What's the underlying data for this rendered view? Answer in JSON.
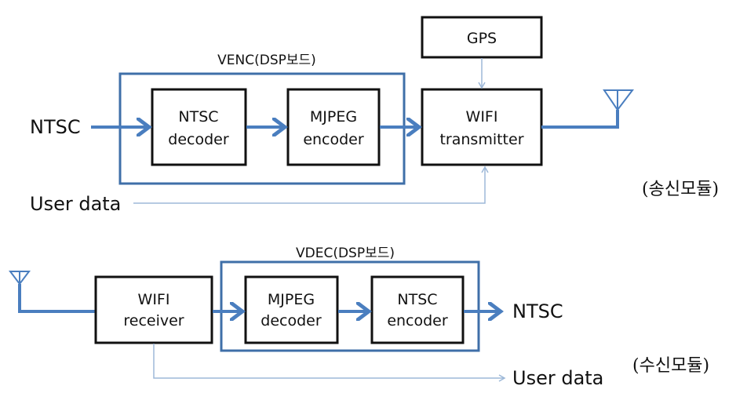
{
  "tx": {
    "group_label": "VENC(DSP보드)",
    "input_label": "NTSC",
    "user_data_label": "User data",
    "blocks": {
      "gps": [
        "GPS"
      ],
      "ntsc_decoder": [
        "NTSC",
        "decoder"
      ],
      "mjpeg_encoder": [
        "MJPEG",
        "encoder"
      ],
      "wifi_transmitter": [
        "WIFI",
        "transmitter"
      ]
    },
    "caption": "(송신모듈)"
  },
  "rx": {
    "group_label": "VDEC(DSP보드)",
    "output_label": "NTSC",
    "user_data_label": "User data",
    "blocks": {
      "wifi_receiver": [
        "WIFI",
        "receiver"
      ],
      "mjpeg_decoder": [
        "MJPEG",
        "decoder"
      ],
      "ntsc_encoder": [
        "NTSC",
        "encoder"
      ]
    },
    "caption": "(수신모듈)"
  },
  "colors": {
    "frame": "#3f6fa8",
    "signal": "#4a7ebf",
    "aux": "#9db8d8"
  }
}
